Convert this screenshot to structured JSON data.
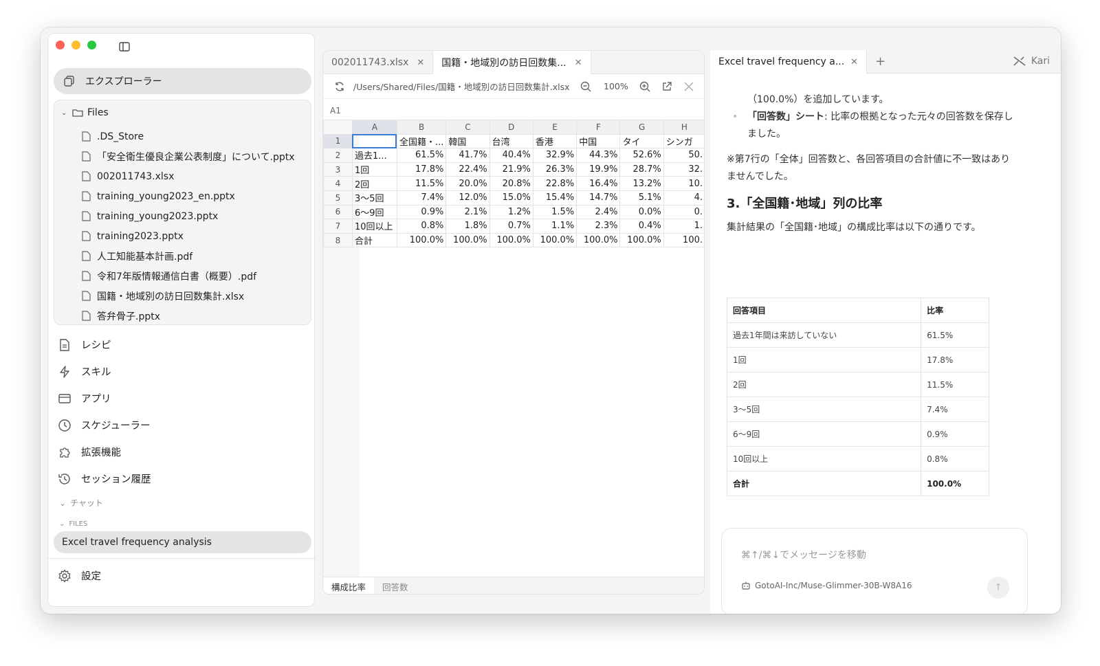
{
  "sidebar": {
    "explorer_label": "エクスプローラー",
    "files_root": "Files",
    "files": [
      ".DS_Store",
      "「安全衛生優良企業公表制度」について.pptx",
      "002011743.xlsx",
      "training_young2023_en.pptx",
      "training_young2023.pptx",
      "training2023.pptx",
      "人工知能基本計画.pdf",
      "令和7年版情報通信白書（概要）.pdf",
      "国籍・地域別の訪日回数集計.xlsx",
      "答弁骨子.pptx"
    ],
    "nav": [
      {
        "label": "レシピ",
        "icon": "document-icon"
      },
      {
        "label": "スキル",
        "icon": "lightning-icon"
      },
      {
        "label": "アプリ",
        "icon": "app-window-icon"
      },
      {
        "label": "スケジューラー",
        "icon": "clock-icon"
      },
      {
        "label": "拡張機能",
        "icon": "puzzle-icon"
      },
      {
        "label": "セッション履歴",
        "icon": "history-icon"
      }
    ],
    "chat_section": "チャット",
    "files_section": "FILES",
    "chat_item": "Excel travel frequency analysis",
    "settings_label": "設定"
  },
  "sheet": {
    "tabs": [
      {
        "label": "002011743.xlsx",
        "active": false
      },
      {
        "label": "国籍・地域別の訪日回数集...",
        "active": true
      }
    ],
    "path": "/Users/Shared/Files/国籍・地域別の訪日回数集計.xlsx",
    "zoom": "100%",
    "cell_ref": "A1",
    "columns": [
      "A",
      "B",
      "C",
      "D",
      "E",
      "F",
      "G",
      "H"
    ],
    "rows": [
      [
        "",
        "全国籍・...",
        "韓国",
        "台湾",
        "香港",
        "中国",
        "タイ",
        "シンガ"
      ],
      [
        "過去1...",
        "61.5%",
        "41.7%",
        "40.4%",
        "32.9%",
        "44.3%",
        "52.6%",
        "50."
      ],
      [
        "1回",
        "17.8%",
        "22.4%",
        "21.9%",
        "26.3%",
        "19.9%",
        "28.7%",
        "32."
      ],
      [
        "2回",
        "11.5%",
        "20.0%",
        "20.8%",
        "22.8%",
        "16.4%",
        "13.2%",
        "10."
      ],
      [
        "3〜5回",
        "7.4%",
        "12.0%",
        "15.0%",
        "15.4%",
        "14.7%",
        "5.1%",
        "4."
      ],
      [
        "6〜9回",
        "0.9%",
        "2.1%",
        "1.2%",
        "1.5%",
        "2.4%",
        "0.0%",
        "0."
      ],
      [
        "10回以上",
        "0.8%",
        "1.8%",
        "0.7%",
        "1.1%",
        "2.3%",
        "0.4%",
        "1."
      ],
      [
        "合計",
        "100.0%",
        "100.0%",
        "100.0%",
        "100.0%",
        "100.0%",
        "100.0%",
        "100."
      ]
    ],
    "sheet_tabs": [
      {
        "label": "構成比率",
        "active": true
      },
      {
        "label": "回答数",
        "active": false
      }
    ]
  },
  "chat": {
    "tab_title": "Excel travel frequency a...",
    "user": "Kari",
    "line1": "（100.0%）を追加しています。",
    "bullet_bold": "「回答数」シート",
    "bullet_text": ": 比率の根拠となった元々の回答数を保存しました。",
    "note": "※第7行の「全体」回答数と、各回答項目の合計値に不一致はありませんでした。",
    "heading": "3.「全国籍･地域」列の比率",
    "intro": "集計結果の「全国籍･地域」の構成比率は以下の通りです。",
    "table_headers": [
      "回答項目",
      "比率"
    ],
    "table_rows": [
      [
        "過去1年間は来訪していない",
        "61.5%"
      ],
      [
        "1回",
        "17.8%"
      ],
      [
        "2回",
        "11.5%"
      ],
      [
        "3〜5回",
        "7.4%"
      ],
      [
        "6〜9回",
        "0.9%"
      ],
      [
        "10回以上",
        "0.8%"
      ]
    ],
    "table_total": [
      "合計",
      "100.0%"
    ],
    "composer_placeholder": "⌘↑/⌘↓でメッセージを移動",
    "model": "GotoAI-Inc/Muse-Glimmer-30B-W8A16"
  }
}
